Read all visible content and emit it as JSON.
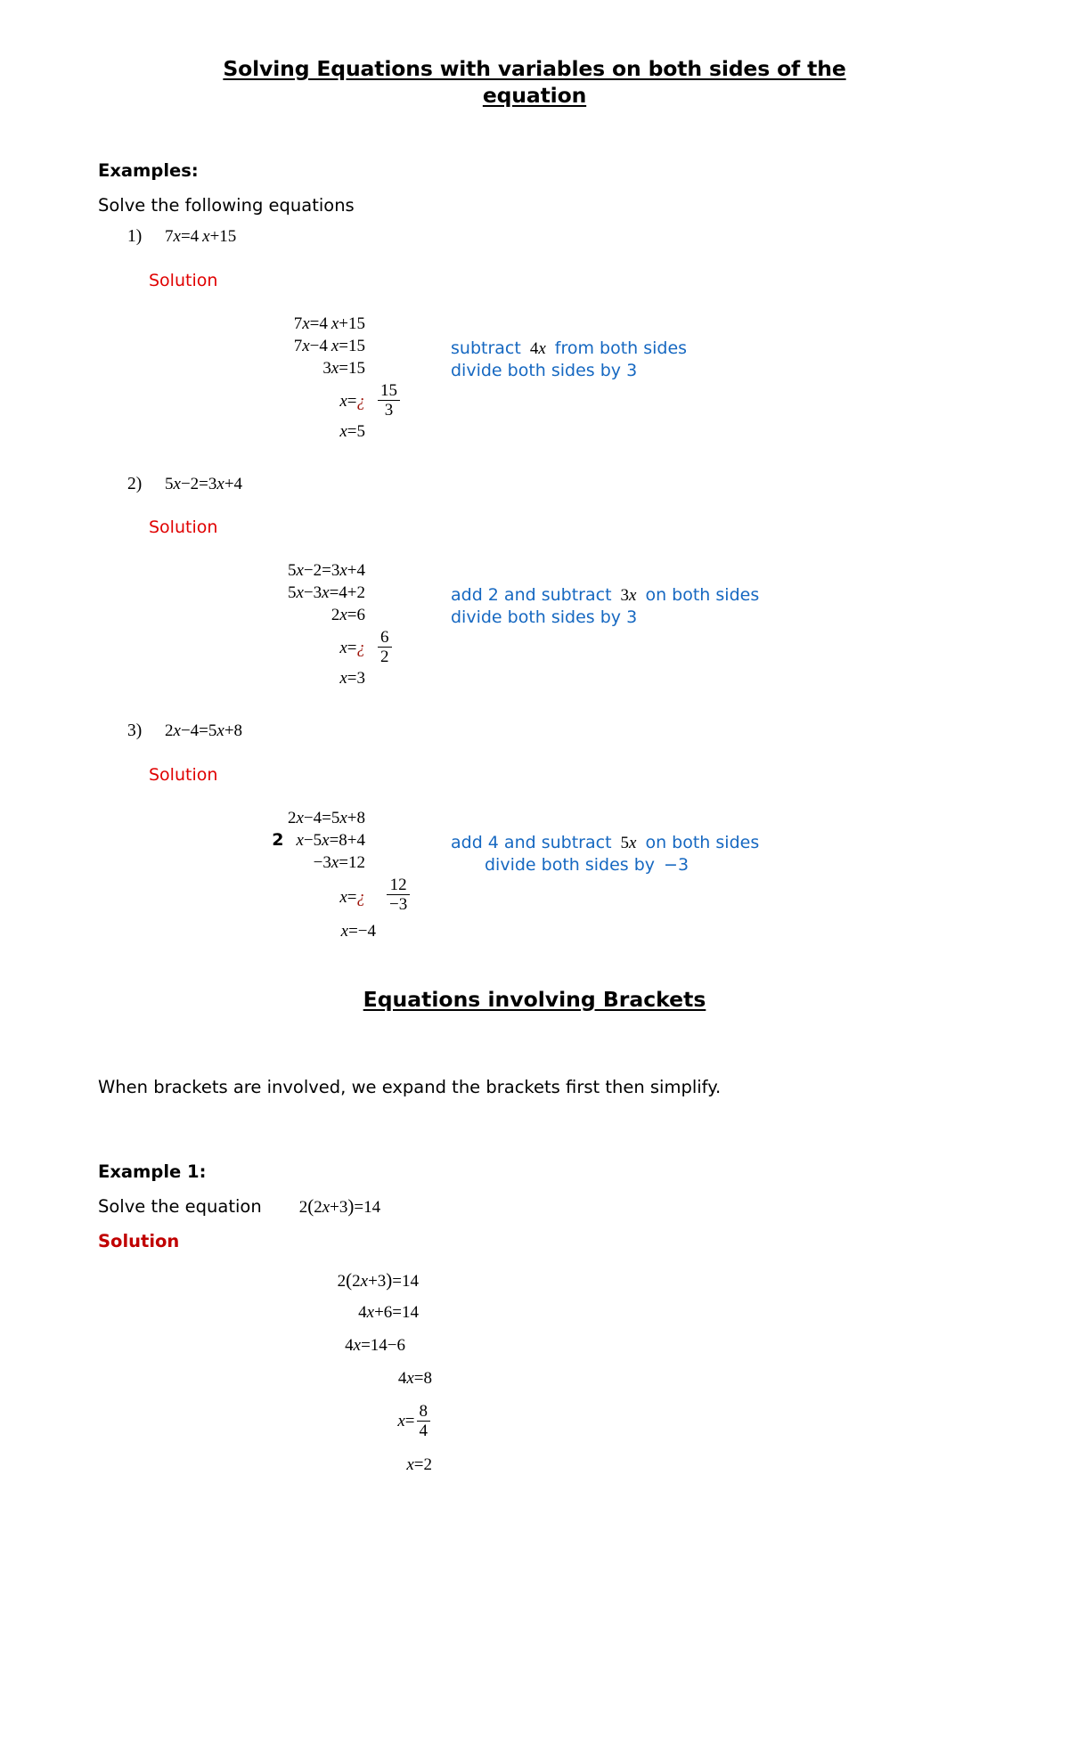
{
  "document": {
    "title": "Solving Equations with variables on both sides of the equation",
    "title_line_1": "Solving Equations with variables on both sides of the",
    "title_line_2": "equation",
    "examples_heading": "Examples:",
    "examples_instruction": "Solve the following equations",
    "solution_label": "Solution",
    "section2_title": "Equations involving Brackets",
    "section2_intro": "When brackets are involved, we expand the brackets first then simplify.",
    "example1_heading": "Example 1:",
    "example1_prompt": "Solve the equation",
    "example1_equation": "2(2x+3)=14",
    "solution_bold_label": "Solution"
  },
  "colors": {
    "solution_red": "#e00000",
    "solution_bold_red": "#c00000",
    "annotation_blue": "#1668c1",
    "question_mark_red": "#9d1309",
    "text_black": "#000000"
  },
  "problems": [
    {
      "number": "1)",
      "equation": "7x=4x+15",
      "solution_label": "Solution",
      "steps": [
        {
          "left": "7x=4x+15",
          "note": ""
        },
        {
          "left": "7x−4x=15",
          "note_parts": [
            {
              "text": "subtract",
              "color": "blue"
            },
            {
              "text": "4x",
              "color": "black"
            },
            {
              "text": "from both sides",
              "color": "blue"
            }
          ]
        },
        {
          "left": "3x=15",
          "note_parts": [
            {
              "text": "divide both sides by",
              "color": "blue"
            },
            {
              "text": "3",
              "color": "blue"
            }
          ]
        },
        {
          "left": "x=¿",
          "fraction": {
            "numerator": "15",
            "denominator": "3"
          },
          "note": ""
        },
        {
          "left": "x=5",
          "note": ""
        }
      ]
    },
    {
      "number": "2)",
      "equation": "5x−2=3x+4",
      "solution_label": "Solution",
      "steps": [
        {
          "left": "5x−2=3x+4",
          "note": ""
        },
        {
          "left": "5x−3x=4+2",
          "note_parts": [
            {
              "text": "add",
              "color": "blue"
            },
            {
              "text": "2",
              "color": "blue"
            },
            {
              "text": "and subtract",
              "color": "blue"
            },
            {
              "text": "3x",
              "color": "black"
            },
            {
              "text": "on both sides",
              "color": "blue"
            }
          ]
        },
        {
          "left": "2x=6",
          "note_parts": [
            {
              "text": "divide both sides by",
              "color": "blue"
            },
            {
              "text": "3",
              "color": "blue"
            }
          ]
        },
        {
          "left": "x=¿",
          "fraction": {
            "numerator": "6",
            "denominator": "2"
          },
          "note": ""
        },
        {
          "left": "x=3",
          "note": ""
        }
      ]
    },
    {
      "number": "3)",
      "equation": "2x−4=5x+8",
      "solution_label": "Solution",
      "steps": [
        {
          "left": "2x−4=5x+8",
          "note": ""
        },
        {
          "prefix": "2",
          "left": "x−5x=8+4",
          "note_parts": [
            {
              "text": "add",
              "color": "blue"
            },
            {
              "text": "4",
              "color": "blue"
            },
            {
              "text": "and subtract",
              "color": "blue"
            },
            {
              "text": "5x",
              "color": "black"
            },
            {
              "text": "on both sides",
              "color": "blue"
            }
          ]
        },
        {
          "left": "−3x=12",
          "note_parts": [
            {
              "text": "divide both sides by",
              "color": "blue"
            },
            {
              "text": "−3",
              "color": "blue"
            }
          ]
        },
        {
          "left": "x=¿",
          "fraction": {
            "numerator": "12",
            "denominator": "−3"
          },
          "note": ""
        },
        {
          "left": "x=−4",
          "note": ""
        }
      ]
    }
  ],
  "bracket_example": {
    "heading": "Example 1:",
    "prompt": "Solve the equation",
    "equation": "2(2x+3)=14",
    "solution_label": "Solution",
    "steps": [
      {
        "text": "2(2x+3)=14"
      },
      {
        "text": "4x+6=14"
      },
      {
        "text": "4x=14−6"
      },
      {
        "text": "4x=8"
      },
      {
        "text": "x=",
        "fraction": {
          "numerator": "8",
          "denominator": "4"
        }
      },
      {
        "text": "x=2"
      }
    ]
  }
}
